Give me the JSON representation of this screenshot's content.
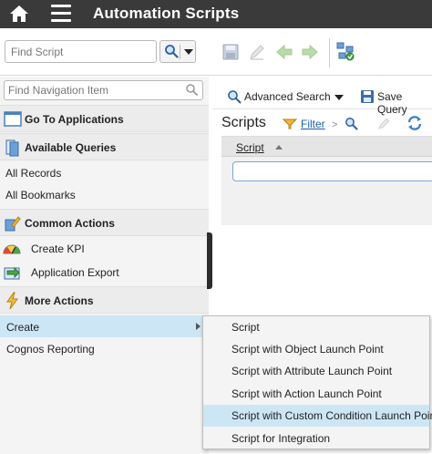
{
  "header": {
    "title": "Automation Scripts",
    "home_icon": "home-icon",
    "menu_icon": "hamburger-menu-icon"
  },
  "toolbar": {
    "find_placeholder": "Find Script",
    "icons": [
      "search-icon",
      "save-icon",
      "edit-icon",
      "previous-icon",
      "next-icon",
      "workflow-icon"
    ]
  },
  "nav": {
    "search_placeholder": "Find Navigation Item",
    "go_to_applications": "Go To Applications",
    "available_queries": "Available Queries",
    "all_records": "All Records",
    "all_bookmarks": "All Bookmarks",
    "common_actions": "Common Actions",
    "create_kpi": "Create KPI",
    "application_export": "Application Export",
    "more_actions": "More Actions",
    "create": "Create",
    "cognos_reporting": "Cognos Reporting"
  },
  "main": {
    "advanced_search": "Advanced Search",
    "save_query": "Save Query",
    "scripts_title": "Scripts",
    "filter": "Filter",
    "column_script": "Script"
  },
  "submenu": {
    "items": [
      "Script",
      "Script with Object Launch Point",
      "Script with Attribute Launch Point",
      "Script with Action Launch Point",
      "Script with Custom Condition Launch Point",
      "Script for Integration"
    ],
    "highlighted": "Script with Custom Condition Launch Point"
  },
  "colors": {
    "header_bg": "#3a3a3a",
    "highlight": "#cde6f5",
    "link": "#1a5fa8"
  }
}
